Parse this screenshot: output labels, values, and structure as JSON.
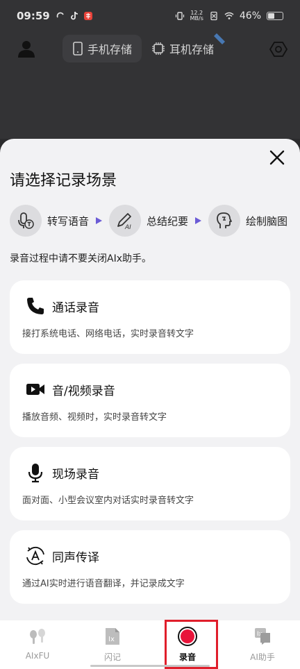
{
  "status_bar": {
    "time": "09:59",
    "network_speed": "12.2\nMB/s",
    "battery": "46%"
  },
  "header": {
    "storage_tabs": [
      {
        "label": "手机存储",
        "active": true
      },
      {
        "label": "耳机存储",
        "active": false
      }
    ]
  },
  "sheet": {
    "title": "请选择记录场景",
    "steps": [
      {
        "label": "转写语音",
        "icon": "mic-t-icon"
      },
      {
        "label": "总结纪要",
        "icon": "pen-ai-icon"
      },
      {
        "label": "绘制脑图",
        "icon": "brain-head-icon"
      }
    ],
    "notice": "录音过程中请不要关闭AIx助手。",
    "cards": [
      {
        "title": "通话录音",
        "desc": "接打系统电话、网络电话，实时录音转文字",
        "icon": "phone-icon"
      },
      {
        "title": "音/视频录音",
        "desc": "播放音频、视频时，实时录音转文字",
        "icon": "video-icon"
      },
      {
        "title": "现场录音",
        "desc": "面对面、小型会议室内对话实时录音转文字",
        "icon": "microphone-icon"
      },
      {
        "title": "同声传译",
        "desc": "通过AI实时进行语音翻译，并记录成文字",
        "icon": "translate-icon"
      }
    ]
  },
  "bottom_nav": [
    {
      "label": "AIxFU",
      "active": false
    },
    {
      "label": "闪记",
      "active": false
    },
    {
      "label": "录音",
      "active": true
    },
    {
      "label": "AI助手",
      "active": false
    }
  ],
  "colors": {
    "accent_arrow": "#6b5bd6",
    "record_red": "#e8143a",
    "highlight": "#e01e2b"
  }
}
